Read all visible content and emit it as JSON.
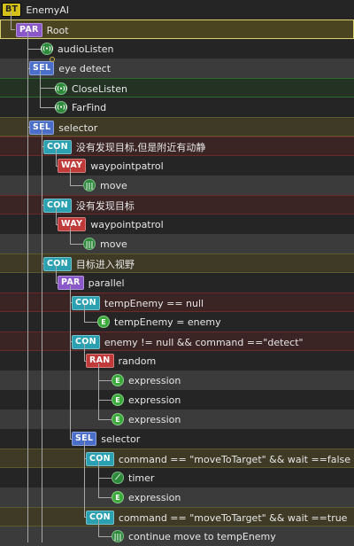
{
  "tree_title": "EnemyAI",
  "nodes": [
    {
      "badge": "BT",
      "icon": "",
      "label": "EnemyAI"
    },
    {
      "badge": "PAR",
      "icon": "",
      "label": "Root"
    },
    {
      "badge": "",
      "icon": "listen-icon",
      "label": "audioListen"
    },
    {
      "badge": "SEL",
      "icon": "",
      "label": "eye detect"
    },
    {
      "badge": "",
      "icon": "listen-icon",
      "label": "CloseListen"
    },
    {
      "badge": "",
      "icon": "listen-icon",
      "label": "FarFind"
    },
    {
      "badge": "SEL",
      "icon": "",
      "label": "selector"
    },
    {
      "badge": "CON",
      "icon": "",
      "label": "没有发现目标,但是附近有动静"
    },
    {
      "badge": "WAY",
      "icon": "",
      "label": "waypointpatrol"
    },
    {
      "badge": "",
      "icon": "move-icon",
      "label": "move"
    },
    {
      "badge": "CON",
      "icon": "",
      "label": "没有发现目标"
    },
    {
      "badge": "WAY",
      "icon": "",
      "label": "waypointpatrol"
    },
    {
      "badge": "",
      "icon": "move-icon",
      "label": "move"
    },
    {
      "badge": "CON",
      "icon": "",
      "label": "目标进入视野"
    },
    {
      "badge": "PAR",
      "icon": "",
      "label": "parallel"
    },
    {
      "badge": "CON",
      "icon": "",
      "label": "tempEnemy == null"
    },
    {
      "badge": "",
      "icon": "expression-icon",
      "label": "tempEnemy = enemy"
    },
    {
      "badge": "CON",
      "icon": "",
      "label": "enemy != null && command ==\"detect\""
    },
    {
      "badge": "RAN",
      "icon": "",
      "label": "random"
    },
    {
      "badge": "",
      "icon": "expression-icon",
      "label": "expression"
    },
    {
      "badge": "",
      "icon": "expression-icon",
      "label": "expression"
    },
    {
      "badge": "",
      "icon": "expression-icon",
      "label": "expression"
    },
    {
      "badge": "SEL",
      "icon": "",
      "label": "selector"
    },
    {
      "badge": "CON",
      "icon": "",
      "label": "command == \"moveToTarget\"  && wait ==false"
    },
    {
      "badge": "",
      "icon": "timer-icon",
      "label": "timer"
    },
    {
      "badge": "",
      "icon": "expression-icon",
      "label": "expression"
    },
    {
      "badge": "CON",
      "icon": "",
      "label": "command == \"moveToTarget\"  && wait ==true"
    },
    {
      "badge": "",
      "icon": "move-icon",
      "label": "continue move to tempEnemy"
    }
  ]
}
